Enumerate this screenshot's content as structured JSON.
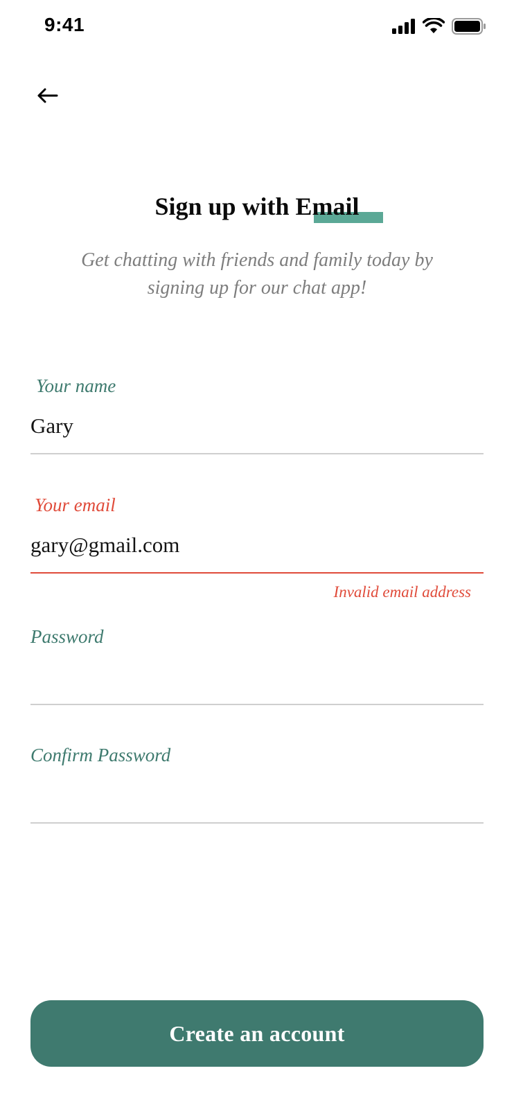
{
  "status_bar": {
    "time": "9:41",
    "icons": [
      "cellular-signal-icon",
      "wifi-icon",
      "battery-icon"
    ]
  },
  "header": {
    "back_icon": "arrow-left-icon",
    "title": "Sign up with Email",
    "subtitle": "Get chatting with friends and family today by signing up for our chat app!"
  },
  "form": {
    "name": {
      "label": "Your name",
      "value": "Gary"
    },
    "email": {
      "label": "Your email",
      "value": "gary@gmail.com",
      "error": "Invalid email address"
    },
    "password": {
      "label": "Password",
      "value": ""
    },
    "confirm_password": {
      "label": "Confirm Password",
      "value": ""
    }
  },
  "actions": {
    "submit_label": "Create an account"
  },
  "colors": {
    "accent": "#3f7a6f",
    "accent_light": "#5ba896",
    "error": "#e04b3a",
    "label": "#3e7a6e",
    "muted": "#7d7d7d",
    "divider": "#cfcfcf"
  }
}
